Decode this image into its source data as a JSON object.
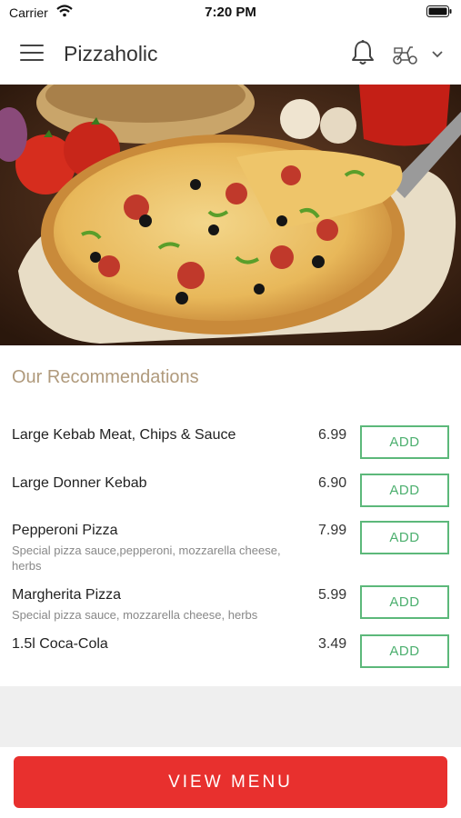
{
  "status_bar": {
    "carrier": "Carrier",
    "time": "7:20 PM"
  },
  "header": {
    "title": "Pizzaholic",
    "bell_icon": "bell-icon",
    "delivery_icon": "scooter-icon",
    "chevron_icon": "chevron-down-icon",
    "menu_icon": "menu-icon"
  },
  "hero": {
    "subject": "pizza-photo"
  },
  "recommendations": {
    "title": "Our Recommendations",
    "items": [
      {
        "name": "Large Kebab Meat, Chips & Sauce",
        "description": "",
        "price": "6.99",
        "button": "ADD"
      },
      {
        "name": "Large Donner Kebab",
        "description": "",
        "price": "6.90",
        "button": "ADD"
      },
      {
        "name": "Pepperoni Pizza",
        "description": "Special pizza sauce,pepperoni, mozzarella cheese, herbs",
        "price": "7.99",
        "button": "ADD"
      },
      {
        "name": "Margherita Pizza",
        "description": "Special pizza sauce, mozzarella cheese, herbs",
        "price": "5.99",
        "button": "ADD"
      },
      {
        "name": "1.5l Coca-Cola",
        "description": "",
        "price": "3.49",
        "button": "ADD"
      }
    ]
  },
  "footer": {
    "view_menu_label": "VIEW MENU"
  },
  "colors": {
    "accent": "#e8302e",
    "add_green": "#5cb87a",
    "section_title": "#b09a7c"
  }
}
